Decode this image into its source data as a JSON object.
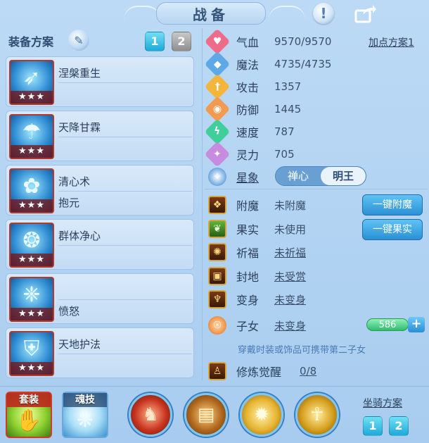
{
  "header": {
    "title": "战备",
    "info_icon": "exclamation-icon",
    "share_icon": "share-icon"
  },
  "left": {
    "heading": "装备方案",
    "pages": [
      "1",
      "2"
    ],
    "skills": [
      {
        "line1": "涅槃重生",
        "line2": "",
        "stars": "★★★",
        "icon": "feather-icon"
      },
      {
        "line1": "天降甘霖",
        "line2": "",
        "stars": "★★★",
        "icon": "rain-icon"
      },
      {
        "line1": "清心术",
        "line2": "抱元",
        "stars": "★★★",
        "icon": "lotus-icon"
      },
      {
        "line1": "群体净心",
        "line2": "",
        "stars": "★★★",
        "icon": "heart-icon"
      },
      {
        "line1": "",
        "line2": "愤怒",
        "stars": "★★★",
        "icon": "flame-icon"
      },
      {
        "line1": "天地护法",
        "line2": "",
        "stars": "★★★",
        "icon": "shield-icon"
      }
    ]
  },
  "stats": {
    "plus_plan": "加点方案1",
    "rows": [
      {
        "label": "气血",
        "value": "9570/9570",
        "color": "#f06a8a",
        "glyph": "♥"
      },
      {
        "label": "魔法",
        "value": "4735/4735",
        "color": "#5ea8e8",
        "glyph": "◆"
      },
      {
        "label": "攻击",
        "value": "1357",
        "color": "#f5b43a",
        "glyph": "†"
      },
      {
        "label": "防御",
        "value": "1445",
        "color": "#f29a52",
        "glyph": "◉"
      },
      {
        "label": "速度",
        "value": "787",
        "color": "#3fcf9a",
        "glyph": "ϟ"
      },
      {
        "label": "灵力",
        "value": "705",
        "color": "#c78be0",
        "glyph": "✦"
      }
    ],
    "star": {
      "label": "星象",
      "left": "禅心",
      "right": "明王"
    }
  },
  "features": [
    {
      "label": "附魔",
      "value": "未附魔",
      "underline": false,
      "glyph": "❖",
      "green": false
    },
    {
      "label": "果实",
      "value": "未使用",
      "underline": false,
      "glyph": "❦",
      "green": true
    },
    {
      "label": "祈福",
      "value": "未祈福",
      "underline": true,
      "glyph": "✺",
      "green": false
    },
    {
      "label": "封地",
      "value": "未受赏",
      "underline": true,
      "glyph": "▣",
      "green": false
    },
    {
      "label": "变身",
      "value": "未变身",
      "underline": true,
      "glyph": "♆",
      "green": false
    },
    {
      "label": "子女",
      "value": "未变身",
      "underline": true,
      "glyph": "☉",
      "green": false
    }
  ],
  "buttons": {
    "enchant": "一键附魔",
    "fruit": "一键果实"
  },
  "child": {
    "hint": "穿戴时装或饰品可携带第二子女",
    "exp": "586",
    "plus": "+"
  },
  "training": {
    "label": "修炼觉醒",
    "value": "0/8"
  },
  "bottom": {
    "set_label": "套装",
    "soul_label": "魂技",
    "mount_label": "坐骑方案",
    "mount_pages": [
      "1",
      "2"
    ]
  }
}
